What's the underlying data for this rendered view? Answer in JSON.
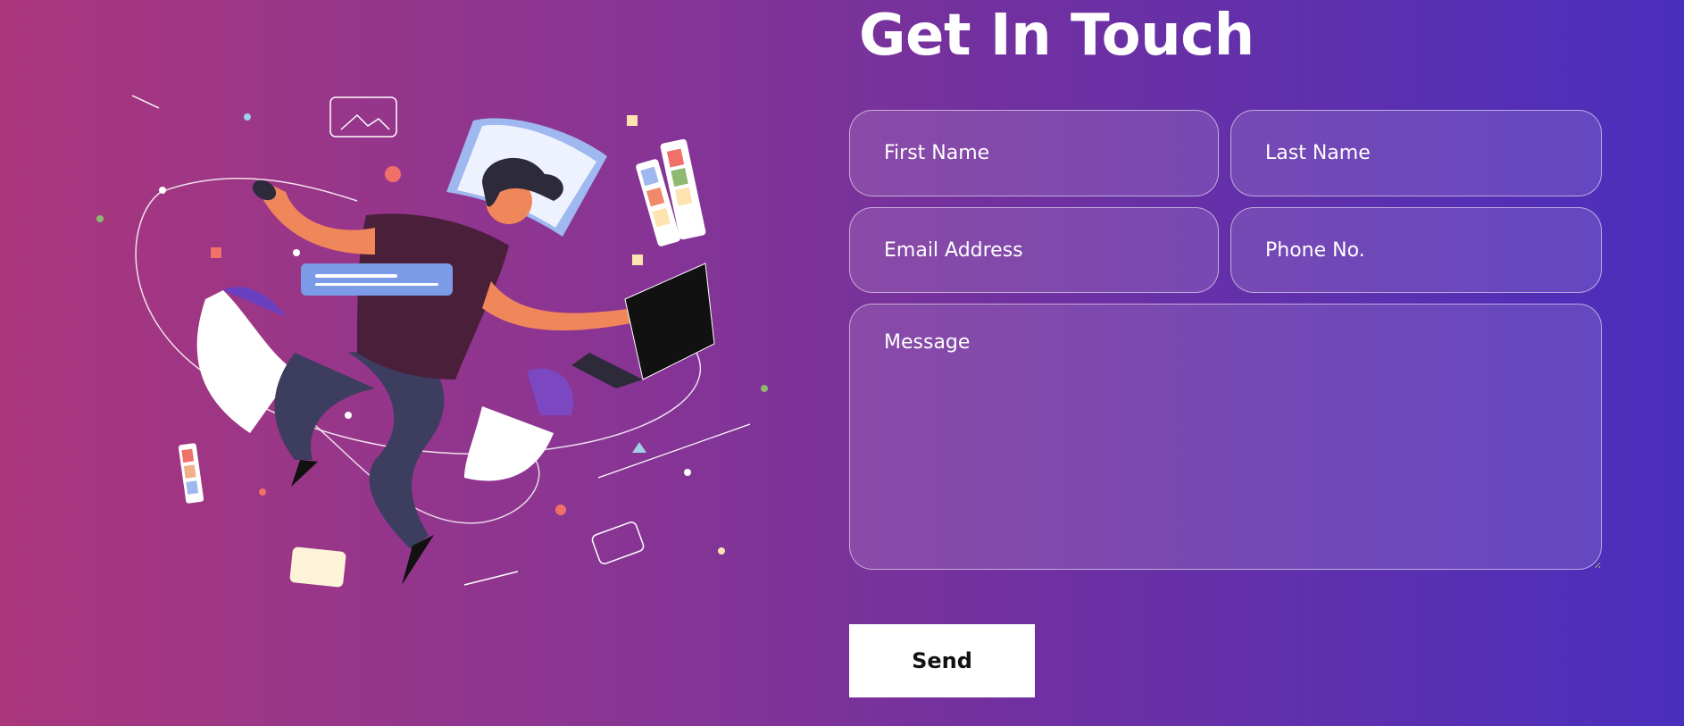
{
  "contact": {
    "title": "Get In Touch",
    "fields": {
      "first_name": "First Name",
      "last_name": "Last Name",
      "email": "Email Address",
      "phone": "Phone No.",
      "message": "Message"
    },
    "send_label": "Send"
  },
  "colors": {
    "gradient_start": "#aa367c",
    "gradient_end": "#4a2fbd",
    "button_bg": "#ffffff"
  }
}
